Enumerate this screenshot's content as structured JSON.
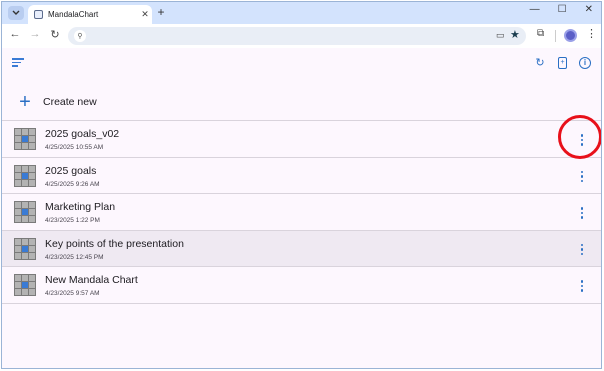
{
  "browser": {
    "tab_title": "MandalaChart",
    "tab_close": "✕",
    "new_tab": "+",
    "controls": {
      "minimize": "—",
      "maximize": "☐",
      "close": "✕"
    },
    "nav": {
      "back": "←",
      "forward": "→",
      "reload": "↻"
    },
    "menu": "⋮"
  },
  "app": {
    "create_label": "Create new",
    "create_icon": "+",
    "charts": [
      {
        "title": "2025 goals_v02",
        "date": "4/25/2025 10:55 AM",
        "highlight": false
      },
      {
        "title": "2025 goals",
        "date": "4/25/2025 9:26 AM",
        "highlight": false
      },
      {
        "title": "Marketing Plan",
        "date": "4/23/2025 1:22 PM",
        "highlight": false
      },
      {
        "title": "Key points of the presentation",
        "date": "4/23/2025 12:45 PM",
        "highlight": true
      },
      {
        "title": "New Mandala Chart",
        "date": "4/23/2025 9:57 AM",
        "highlight": false
      }
    ]
  },
  "colors": {
    "accent": "#2a6fc4",
    "annotation": "#e8101a",
    "background": "#fdf7fe"
  },
  "icons": {
    "sort": "sort-icon",
    "refresh": "refresh-icon",
    "new_file": "new-file-icon",
    "info": "info-icon",
    "more": "more-vert-icon",
    "thumbnail": "mandala-grid-icon"
  }
}
